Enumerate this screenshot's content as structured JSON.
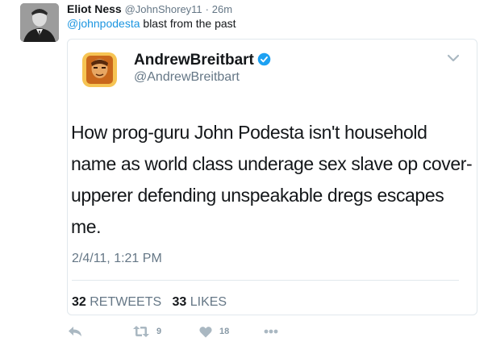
{
  "tweet": {
    "display_name": "Eliot Ness",
    "handle": "@JohnShorey11",
    "separator": "·",
    "time": "26m",
    "mention": "@johnpodesta",
    "text": " blast from the past",
    "avatar_icon": "user-photo-avatar"
  },
  "embedded_tweet": {
    "display_name": "AndrewBreitbart",
    "handle": "@AndrewBreitbart",
    "verified": true,
    "text": "How prog-guru John Podesta isn't household name as world class underage sex slave op cover-upperer defending unspeakable dregs escapes me.",
    "date": "2/4/11, 1:21 PM",
    "retweets_count": "32",
    "retweets_label": "RETWEETS",
    "likes_count": "33",
    "likes_label": "LIKES"
  },
  "actions": {
    "reply_icon": "reply-icon",
    "retweet_icon": "retweet-icon",
    "retweet_count": "9",
    "like_icon": "heart-icon",
    "like_count": "18",
    "more_icon": "more-icon"
  },
  "colors": {
    "link": "#1b95e0",
    "muted": "#657786",
    "icon": "#aab8c2",
    "verified": "#1da1f2"
  }
}
